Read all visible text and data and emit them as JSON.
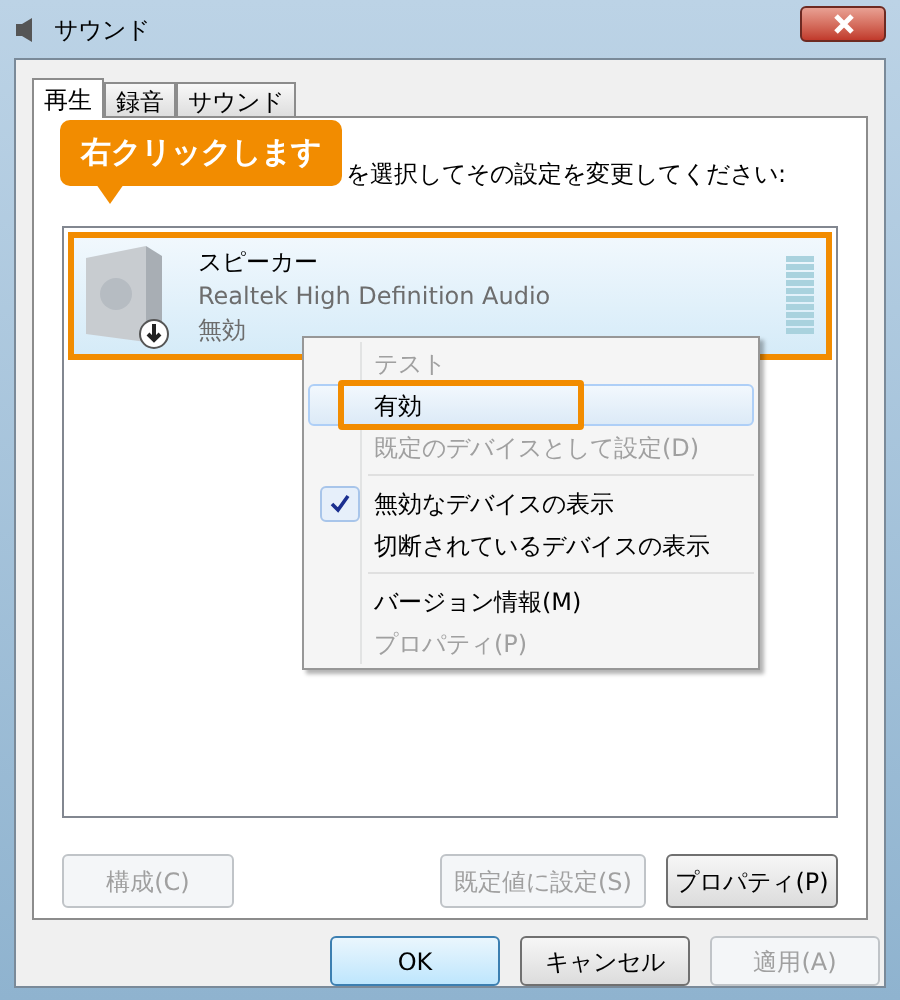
{
  "window": {
    "title": "サウンド"
  },
  "tabs": [
    {
      "label": "再生",
      "selected": true
    },
    {
      "label": "録音",
      "selected": false
    },
    {
      "label": "サウンド",
      "selected": false
    }
  ],
  "callout": "右クリックします",
  "instruction": "を選択してその設定を変更してください:",
  "devices": [
    {
      "name": "スピーカー",
      "driver": "Realtek High Definition Audio",
      "status": "無効",
      "selected": true
    }
  ],
  "context_menu": [
    {
      "kind": "item",
      "label": "テスト",
      "disabled": true,
      "checked": false,
      "selected": false
    },
    {
      "kind": "item",
      "label": "有効",
      "disabled": false,
      "checked": false,
      "selected": true
    },
    {
      "kind": "item",
      "label": "既定のデバイスとして設定(D)",
      "disabled": true,
      "checked": false,
      "selected": false
    },
    {
      "kind": "separator"
    },
    {
      "kind": "item",
      "label": "無効なデバイスの表示",
      "disabled": false,
      "checked": true,
      "selected": false
    },
    {
      "kind": "item",
      "label": "切断されているデバイスの表示",
      "disabled": false,
      "checked": false,
      "selected": false
    },
    {
      "kind": "separator"
    },
    {
      "kind": "item",
      "label": "バージョン情報(M)",
      "disabled": false,
      "checked": false,
      "selected": false
    },
    {
      "kind": "item",
      "label": "プロパティ(P)",
      "disabled": true,
      "checked": false,
      "selected": false
    }
  ],
  "panel_buttons": [
    {
      "label": "構成(C)",
      "disabled": true
    },
    {
      "label": "既定値に設定(S)",
      "disabled": true
    },
    {
      "label": "プロパティ(P)",
      "disabled": false
    }
  ],
  "dialog_buttons": [
    {
      "label": "OK",
      "disabled": false
    },
    {
      "label": "キャンセル",
      "disabled": false
    },
    {
      "label": "適用(A)",
      "disabled": true
    }
  ]
}
